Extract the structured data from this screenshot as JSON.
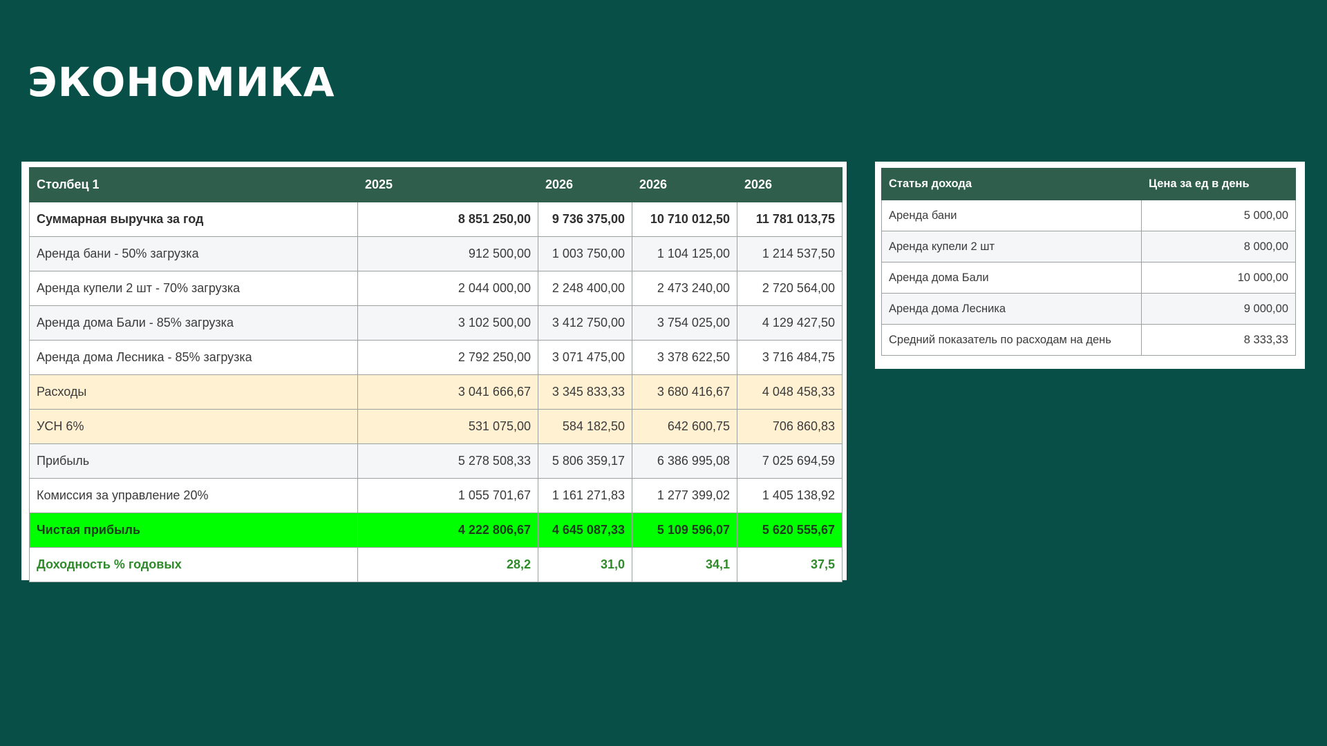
{
  "title": "ЭКОНОМИКА",
  "main_table": {
    "headers": [
      "Столбец 1",
      "2025",
      "2026",
      "2026",
      "2026"
    ],
    "rows": [
      {
        "label": "Суммарная выручка за год",
        "values": [
          "8 851 250,00",
          "9 736 375,00",
          "10 710 012,50",
          "11 781 013,75"
        ]
      },
      {
        "label": "Аренда бани - 50% загрузка",
        "values": [
          "912 500,00",
          "1 003 750,00",
          "1 104 125,00",
          "1 214 537,50"
        ]
      },
      {
        "label": "Аренда купели 2 шт - 70% загрузка",
        "values": [
          "2 044 000,00",
          "2 248 400,00",
          "2 473 240,00",
          "2 720 564,00"
        ]
      },
      {
        "label": "Аренда дома Бали - 85% загрузка",
        "values": [
          "3 102 500,00",
          "3 412 750,00",
          "3 754 025,00",
          "4 129 427,50"
        ]
      },
      {
        "label": "Аренда дома Лесника - 85% загрузка",
        "values": [
          "2 792 250,00",
          "3 071 475,00",
          "3 378 622,50",
          "3 716 484,75"
        ]
      },
      {
        "label": "Расходы",
        "values": [
          "3 041 666,67",
          "3 345 833,33",
          "3 680 416,67",
          "4 048 458,33"
        ]
      },
      {
        "label": "УСН 6%",
        "values": [
          "531 075,00",
          "584 182,50",
          "642 600,75",
          "706 860,83"
        ]
      },
      {
        "label": "Прибыль",
        "values": [
          "5 278 508,33",
          "5 806 359,17",
          "6 386 995,08",
          "7 025 694,59"
        ]
      },
      {
        "label": "Комиссия за управление 20%",
        "values": [
          "1 055 701,67",
          "1 161 271,83",
          "1 277 399,02",
          "1 405 138,92"
        ]
      },
      {
        "label": "Чистая прибыль",
        "values": [
          "4 222 806,67",
          "4 645 087,33",
          "5 109 596,07",
          "5 620 555,67"
        ]
      },
      {
        "label": "Доходность % годовых",
        "values": [
          "28,2",
          "31,0",
          "34,1",
          "37,5"
        ]
      }
    ]
  },
  "side_table": {
    "headers": [
      "Статья дохода",
      "Цена за ед в день"
    ],
    "rows": [
      {
        "label": "Аренда бани",
        "value": "5 000,00"
      },
      {
        "label": "Аренда купели 2 шт",
        "value": "8 000,00"
      },
      {
        "label": "Аренда дома Бали",
        "value": "10 000,00"
      },
      {
        "label": "Аренда дома Лесника",
        "value": "9 000,00"
      },
      {
        "label": "Средний показатель по расходам на день",
        "value": "8 333,33"
      }
    ]
  },
  "colors": {
    "background": "#084f47",
    "header": "#2f5e4d",
    "expense_row": "#fff1d2",
    "net_profit_row": "#00ff00",
    "yield_text": "#2f8a2a"
  }
}
